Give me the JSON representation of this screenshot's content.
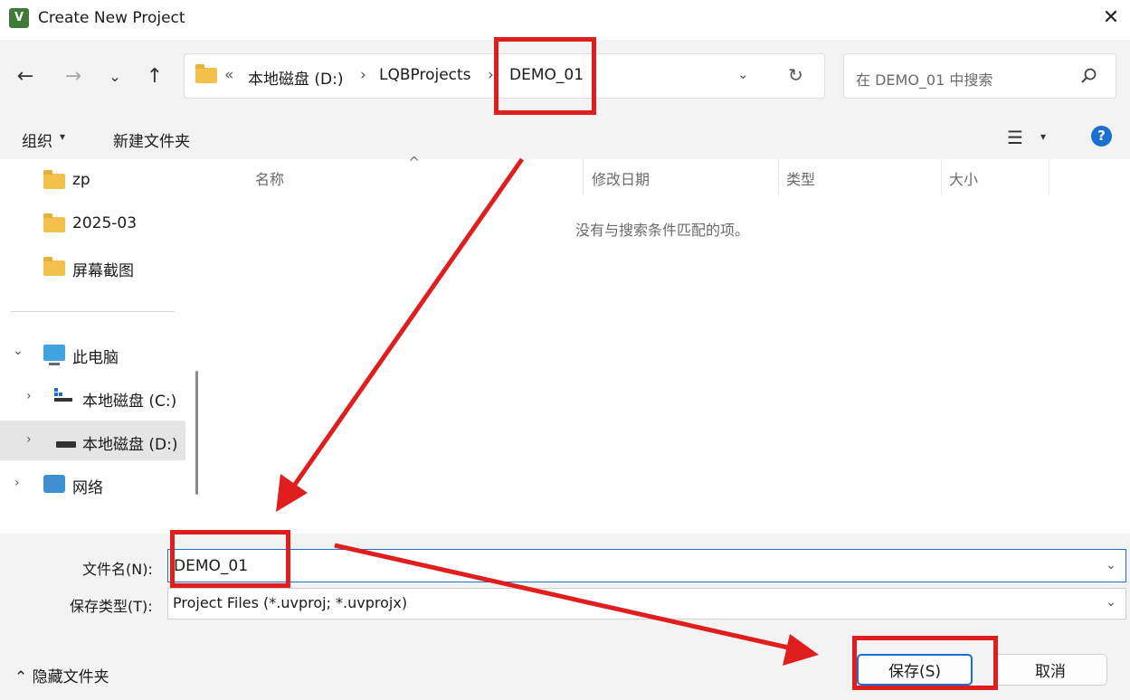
{
  "window": {
    "title": "Create New Project",
    "app_icon_letter": "V",
    "close_icon": "close-icon"
  },
  "nav": {
    "back_icon": "←",
    "forward_icon": "→",
    "recent_icon": "⌄",
    "up_icon": "↑",
    "breadcrumbs": [
      "本地磁盘 (D:)",
      "LQBProjects",
      "DEMO_01"
    ],
    "more_symbol": "«",
    "separator": "›",
    "dropdown_icon": "⌄",
    "refresh_icon": "↻"
  },
  "search": {
    "placeholder": "在 DEMO_01 中搜索"
  },
  "toolbar": {
    "organize_label": "组织",
    "organize_arrow": "▾",
    "new_folder_label": "新建文件夹",
    "view_icon": "☰",
    "view_dropdown": "▾",
    "help_symbol": "?"
  },
  "sidebar": {
    "quick_access": [
      "zp",
      "2025-03",
      "屏幕截图"
    ],
    "this_pc_label": "此电脑",
    "drives": [
      "本地磁盘 (C:)",
      "本地磁盘 (D:)"
    ],
    "network_label": "网络",
    "expanded_chevron": "⌄",
    "collapsed_chevron": "›"
  },
  "content": {
    "columns": [
      "名称",
      "修改日期",
      "类型",
      "大小"
    ],
    "sort_caret": "^",
    "empty_message": "没有与搜索条件匹配的项。"
  },
  "form": {
    "filename_label": "文件名(N):",
    "filename_value": "DEMO_01",
    "filetype_label": "保存类型(T):",
    "filetype_value": "Project Files (*.uvproj; *.uvprojx)",
    "dropdown_icon": "⌄"
  },
  "footer": {
    "hide_folders_label": "隐藏文件夹",
    "hide_folders_icon": "⌃",
    "save_label": "保存(S)",
    "cancel_label": "取消"
  },
  "colors": {
    "annotation_red": "#e01e1e",
    "accent_blue": "#1a6fd1",
    "folder_yellow": "#f3c14a"
  }
}
